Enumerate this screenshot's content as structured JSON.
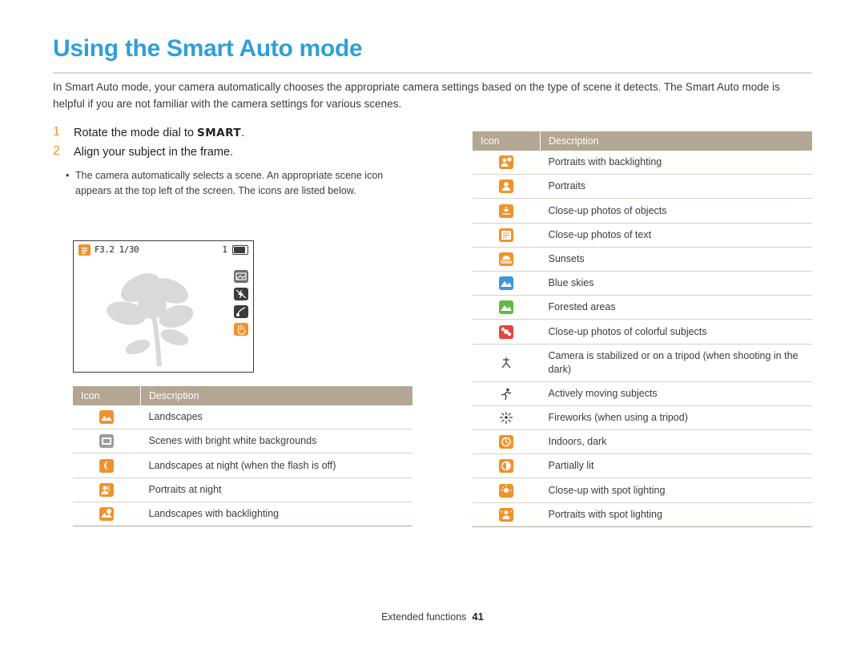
{
  "title": "Using the Smart Auto mode",
  "intro": "In Smart Auto mode, your camera automatically chooses the appropriate camera settings based on the type of scene it detects. The Smart Auto mode is helpful if you are not familiar with the camera settings for various scenes.",
  "steps": [
    {
      "num": "1",
      "text_before": "Rotate the mode dial to ",
      "badge": "SMART",
      "text_after": "."
    },
    {
      "num": "2",
      "text_before": "Align your subject in the frame.",
      "badge": "",
      "text_after": ""
    }
  ],
  "bullet": "The camera automatically selects a scene. An appropriate scene icon appears at the top left of the screen. The icons are listed below.",
  "camera_screen": {
    "mode_icon": "smart-auto-icon",
    "aperture": "F3.2",
    "shutter": "1/30",
    "shots_remaining": "1",
    "battery_icon": "battery-icon",
    "side_icons": [
      "exposure-icon",
      "flash-off-icon",
      "macro-icon",
      "ois-icon"
    ],
    "subject_icon": "flower-illustration"
  },
  "left_table": {
    "headers": [
      "Icon",
      "Description"
    ],
    "rows": [
      {
        "icon": "landscape-icon",
        "description": "Landscapes"
      },
      {
        "icon": "white-background-icon",
        "description": "Scenes with bright white backgrounds"
      },
      {
        "icon": "night-landscape-icon",
        "description": "Landscapes at night (when the flash is off)"
      },
      {
        "icon": "night-portrait-icon",
        "description": "Portraits at night"
      },
      {
        "icon": "backlight-landscape-icon",
        "description": "Landscapes with backlighting"
      }
    ]
  },
  "right_table": {
    "headers": [
      "Icon",
      "Description"
    ],
    "rows": [
      {
        "icon": "backlight-portrait-icon",
        "description": "Portraits with backlighting"
      },
      {
        "icon": "portrait-icon",
        "description": "Portraits"
      },
      {
        "icon": "macro-object-icon",
        "description": "Close-up photos of objects"
      },
      {
        "icon": "macro-text-icon",
        "description": "Close-up photos of text"
      },
      {
        "icon": "sunset-icon",
        "description": "Sunsets"
      },
      {
        "icon": "blue-sky-icon",
        "description": "Blue skies"
      },
      {
        "icon": "forest-icon",
        "description": "Forested areas"
      },
      {
        "icon": "macro-color-icon",
        "description": "Close-up photos of colorful subjects"
      },
      {
        "icon": "tripod-icon",
        "description": "Camera is stabilized or on a tripod (when shooting in the dark)"
      },
      {
        "icon": "action-icon",
        "description": "Actively moving subjects"
      },
      {
        "icon": "fireworks-icon",
        "description": "Fireworks (when using a tripod)"
      },
      {
        "icon": "indoor-dark-icon",
        "description": "Indoors, dark"
      },
      {
        "icon": "partially-lit-icon",
        "description": "Partially lit"
      },
      {
        "icon": "macro-spotlight-icon",
        "description": "Close-up with spot lighting"
      },
      {
        "icon": "portrait-spotlight-icon",
        "description": "Portraits with spot lighting"
      }
    ]
  },
  "footer": {
    "section": "Extended functions",
    "page": "41"
  },
  "colors": {
    "title": "#2f9fd8",
    "table_header": "#b3a692",
    "step_number": "#f0922b"
  }
}
